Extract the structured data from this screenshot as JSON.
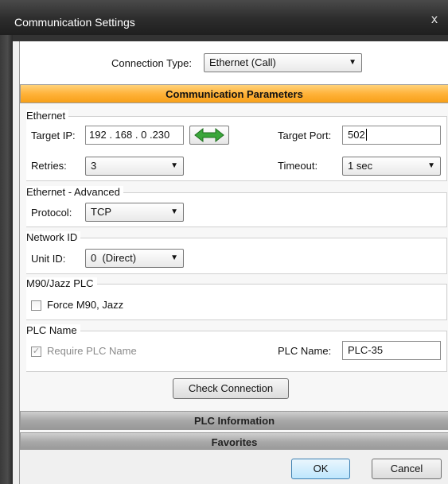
{
  "window": {
    "title": "Communication Settings",
    "close_glyph": "x"
  },
  "connection": {
    "label": "Connection Type:",
    "value": "Ethernet (Call)"
  },
  "sections": {
    "parameters": "Communication Parameters",
    "plc_information": "PLC Information",
    "favorites": "Favorites"
  },
  "ethernet": {
    "title": "Ethernet",
    "target_ip_label": "Target IP:",
    "ip": [
      "192",
      "168",
      "0",
      "230"
    ],
    "target_port_label": "Target Port:",
    "target_port_value": "502",
    "retries_label": "Retries:",
    "retries_value": "3",
    "timeout_label": "Timeout:",
    "timeout_value": "1 sec"
  },
  "advanced": {
    "title": "Ethernet - Advanced",
    "protocol_label": "Protocol:",
    "protocol_value": "TCP"
  },
  "network": {
    "title": "Network ID",
    "unit_label": "Unit ID:",
    "unit_value": "0  (Direct)"
  },
  "m90": {
    "title": "M90/Jazz PLC",
    "checkbox_label": "Force M90, Jazz"
  },
  "plc_name": {
    "title": "PLC Name",
    "require_label": "Require PLC Name",
    "require_checked_glyph": "✓",
    "name_label": "PLC Name:",
    "name_value": "PLC-35"
  },
  "buttons": {
    "check_connection": "Check Connection",
    "ok": "OK",
    "cancel": "Cancel"
  },
  "icons": {
    "close": "close-icon",
    "dropdown": "chevron-down-icon",
    "swap": "swap-arrows-icon"
  },
  "colors": {
    "accent_orange": "#ffb23a",
    "arrow_green": "#3aa63a",
    "titlebar": "#2c2c2c"
  }
}
